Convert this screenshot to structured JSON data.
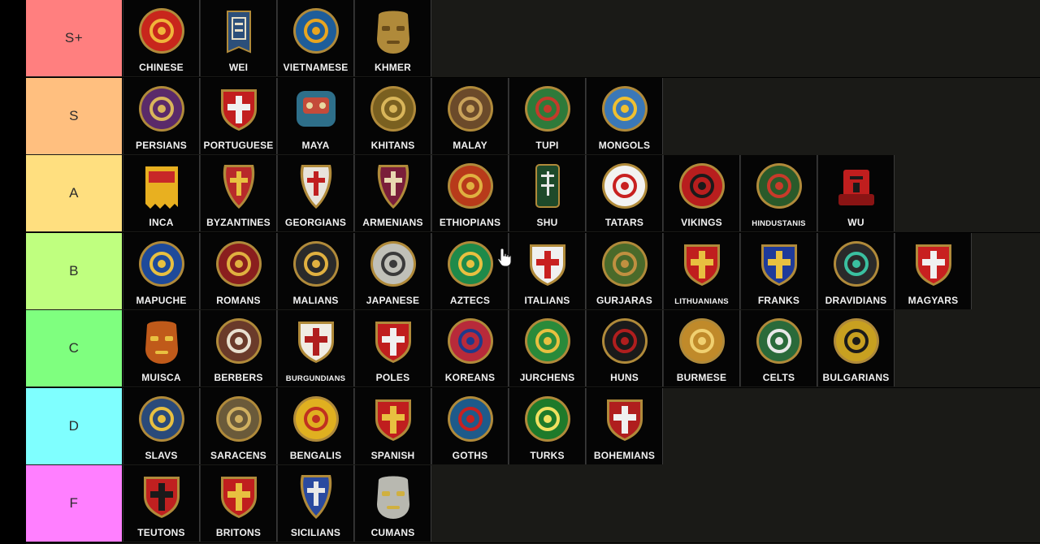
{
  "tiers": [
    {
      "label": "S+",
      "color": "#ff7f7f",
      "items": [
        {
          "name": "CHINESE",
          "shape": "round",
          "fill": "#c8261c",
          "accent": "#f0b43a",
          "icon": "endless-knot-icon"
        },
        {
          "name": "WEI",
          "shape": "banner",
          "fill": "#2c4f7a",
          "accent": "#e8e0c8",
          "icon": "wei-banner-icon"
        },
        {
          "name": "VIETNAMESE",
          "shape": "round",
          "fill": "#1e5d9a",
          "accent": "#e8a520",
          "icon": "sun-icon"
        },
        {
          "name": "KHMER",
          "shape": "head",
          "fill": "#b08a3a",
          "accent": "#6b4d1a",
          "icon": "stone-face-icon"
        }
      ]
    },
    {
      "label": "S",
      "color": "#ffbf7f",
      "items": [
        {
          "name": "PERSIANS",
          "shape": "round",
          "fill": "#5a2a6a",
          "accent": "#d9b65a",
          "icon": "griffin-icon"
        },
        {
          "name": "PORTUGUESE",
          "shape": "shield",
          "fill": "#c21e1e",
          "accent": "#f0f0f0",
          "icon": "quinas-icon"
        },
        {
          "name": "MAYA",
          "shape": "glyph",
          "fill": "#2e6f8a",
          "accent": "#c44b3a",
          "icon": "maya-glyph-icon"
        },
        {
          "name": "KHITANS",
          "shape": "round",
          "fill": "#7a6020",
          "accent": "#d9b65a",
          "icon": "dragon-icon"
        },
        {
          "name": "MALAY",
          "shape": "round",
          "fill": "#6b4a2a",
          "accent": "#c9a25a",
          "icon": "studded-shield-icon"
        },
        {
          "name": "TUPI",
          "shape": "round",
          "fill": "#2e7a3a",
          "accent": "#c43a2a",
          "icon": "pattern-icon"
        },
        {
          "name": "MONGOLS",
          "shape": "round",
          "fill": "#3a78b8",
          "accent": "#f0c030",
          "icon": "soyombo-icon"
        }
      ]
    },
    {
      "label": "A",
      "color": "#ffdf7f",
      "items": [
        {
          "name": "INCA",
          "shape": "banner-square",
          "fill": "#e8b020",
          "accent": "#c82828",
          "icon": "inca-banner-icon"
        },
        {
          "name": "BYZANTINES",
          "shape": "kite",
          "fill": "#b82a2a",
          "accent": "#e8c040",
          "icon": "byzantine-cross-icon"
        },
        {
          "name": "GEORGIANS",
          "shape": "kite",
          "fill": "#e8e4dc",
          "accent": "#c02020",
          "icon": "georgian-cross-icon"
        },
        {
          "name": "ARMENIANS",
          "shape": "kite",
          "fill": "#7a1e3a",
          "accent": "#e8d8b0",
          "icon": "lion-cross-icon"
        },
        {
          "name": "ETHIOPIANS",
          "shape": "round",
          "fill": "#b83a1a",
          "accent": "#e0b040",
          "icon": "ethiopian-cross-icon"
        },
        {
          "name": "SHU",
          "shape": "tower",
          "fill": "#1e4a2a",
          "accent": "#e8e8e8",
          "icon": "shu-banner-icon"
        },
        {
          "name": "TATARS",
          "shape": "round",
          "fill": "#f2f2f2",
          "accent": "#c82020",
          "icon": "tamga-icon"
        },
        {
          "name": "VIKINGS",
          "shape": "round",
          "fill": "#b81e1e",
          "accent": "#1a1a1a",
          "icon": "raven-icon"
        },
        {
          "name": "HINDUSTANIS",
          "shape": "round",
          "fill": "#2a5a2a",
          "accent": "#c83a2a",
          "icon": "star-medallion-icon",
          "small": true
        },
        {
          "name": "WU",
          "shape": "wu",
          "fill": "#c01e1e",
          "accent": "#1a1a1a",
          "icon": "wu-banner-icon"
        }
      ]
    },
    {
      "label": "B",
      "color": "#bfff7f",
      "items": [
        {
          "name": "MAPUCHE",
          "shape": "round",
          "fill": "#1e4a9a",
          "accent": "#e8c040",
          "icon": "mapuche-star-icon"
        },
        {
          "name": "ROMANS",
          "shape": "round",
          "fill": "#8a1e1e",
          "accent": "#e0b040",
          "icon": "eagle-icon"
        },
        {
          "name": "MALIANS",
          "shape": "round",
          "fill": "#2a2a2a",
          "accent": "#e0b040",
          "icon": "mali-stripes-icon"
        },
        {
          "name": "JAPANESE",
          "shape": "round",
          "fill": "#c0c0b8",
          "accent": "#3a3a3a",
          "icon": "chrysanthemum-icon"
        },
        {
          "name": "AZTECS",
          "shape": "round",
          "fill": "#1e8a4a",
          "accent": "#e8c040",
          "icon": "aztec-shield-icon"
        },
        {
          "name": "ITALIANS",
          "shape": "shield",
          "fill": "#f0f0f0",
          "accent": "#c82020",
          "icon": "red-cross-icon"
        },
        {
          "name": "GURJARAS",
          "shape": "round",
          "fill": "#4a6a2a",
          "accent": "#c09040",
          "icon": "studded-round-icon"
        },
        {
          "name": "LITHUANIANS",
          "shape": "shield",
          "fill": "#c01e1e",
          "accent": "#e8c040",
          "icon": "columns-icon",
          "small": true
        },
        {
          "name": "FRANKS",
          "shape": "shield",
          "fill": "#1e3a9a",
          "accent": "#e8c040",
          "icon": "fleur-de-lis-icon"
        },
        {
          "name": "DRAVIDIANS",
          "shape": "round",
          "fill": "#2a2a2a",
          "accent": "#3ac0a0",
          "icon": "gem-studs-icon"
        },
        {
          "name": "MAGYARS",
          "shape": "shield",
          "fill": "#c82020",
          "accent": "#f0f0f0",
          "icon": "stripes-icon"
        }
      ]
    },
    {
      "label": "C",
      "color": "#7fff7f",
      "items": [
        {
          "name": "MUISCA",
          "shape": "head",
          "fill": "#c05a1a",
          "accent": "#e8c040",
          "icon": "muisca-mask-icon"
        },
        {
          "name": "BERBERS",
          "shape": "round",
          "fill": "#6a3a2a",
          "accent": "#e8e0d0",
          "icon": "yaz-icon"
        },
        {
          "name": "BURGUNDIANS",
          "shape": "shield",
          "fill": "#f0ece4",
          "accent": "#b01e1e",
          "icon": "saltire-icon",
          "small": true
        },
        {
          "name": "POLES",
          "shape": "shield",
          "fill": "#c01e1e",
          "accent": "#f0f0f0",
          "icon": "white-eagle-icon"
        },
        {
          "name": "KOREANS",
          "shape": "round",
          "fill": "#b82a3a",
          "accent": "#1e3a8a",
          "icon": "taeguk-icon"
        },
        {
          "name": "JURCHENS",
          "shape": "round",
          "fill": "#2a8a3a",
          "accent": "#e8c040",
          "icon": "jurchen-icon"
        },
        {
          "name": "HUNS",
          "shape": "round",
          "fill": "#1a1a1a",
          "accent": "#b01e1e",
          "icon": "horse-head-icon"
        },
        {
          "name": "BURMESE",
          "shape": "round",
          "fill": "#c08a2a",
          "accent": "#f0d070",
          "icon": "peacock-icon"
        },
        {
          "name": "CELTS",
          "shape": "round",
          "fill": "#2a6a3a",
          "accent": "#e8e8e8",
          "icon": "triskelion-icon"
        },
        {
          "name": "BULGARIANS",
          "shape": "round",
          "fill": "#c8a020",
          "accent": "#1a1a1a",
          "icon": "lions-icon"
        }
      ]
    },
    {
      "label": "D",
      "color": "#7fffff",
      "items": [
        {
          "name": "SLAVS",
          "shape": "round",
          "fill": "#2a4a7a",
          "accent": "#e8c040",
          "icon": "trident-icon"
        },
        {
          "name": "SARACENS",
          "shape": "round",
          "fill": "#6a5a3a",
          "accent": "#d0b060",
          "icon": "octagram-icon"
        },
        {
          "name": "BENGALIS",
          "shape": "round",
          "fill": "#e0b020",
          "accent": "#c03020",
          "icon": "bengali-motif-icon"
        },
        {
          "name": "SPANISH",
          "shape": "shield",
          "fill": "#c01e1e",
          "accent": "#e8c040",
          "icon": "castle-lion-icon"
        },
        {
          "name": "GOTHS",
          "shape": "round",
          "fill": "#1e5a8a",
          "accent": "#c82020",
          "icon": "gothic-figure-icon"
        },
        {
          "name": "TURKS",
          "shape": "round",
          "fill": "#1e7a2a",
          "accent": "#f0e060",
          "icon": "crescent-star-icon"
        },
        {
          "name": "BOHEMIANS",
          "shape": "shield",
          "fill": "#b01e1e",
          "accent": "#f0f0f0",
          "icon": "bohemian-lion-icon"
        }
      ]
    },
    {
      "label": "F",
      "color": "#ff7fff",
      "items": [
        {
          "name": "TEUTONS",
          "shape": "shield",
          "fill": "#c02020",
          "accent": "#1a1a1a",
          "icon": "black-eagle-icon"
        },
        {
          "name": "BRITONS",
          "shape": "shield",
          "fill": "#c01e1e",
          "accent": "#e8c040",
          "icon": "three-lions-icon"
        },
        {
          "name": "SICILIANS",
          "shape": "kite",
          "fill": "#2a4aa0",
          "accent": "#e8e8e8",
          "icon": "sicilian-kite-icon"
        },
        {
          "name": "CUMANS",
          "shape": "head",
          "fill": "#b8b8b0",
          "accent": "#d0b040",
          "icon": "face-mask-icon"
        }
      ]
    }
  ]
}
